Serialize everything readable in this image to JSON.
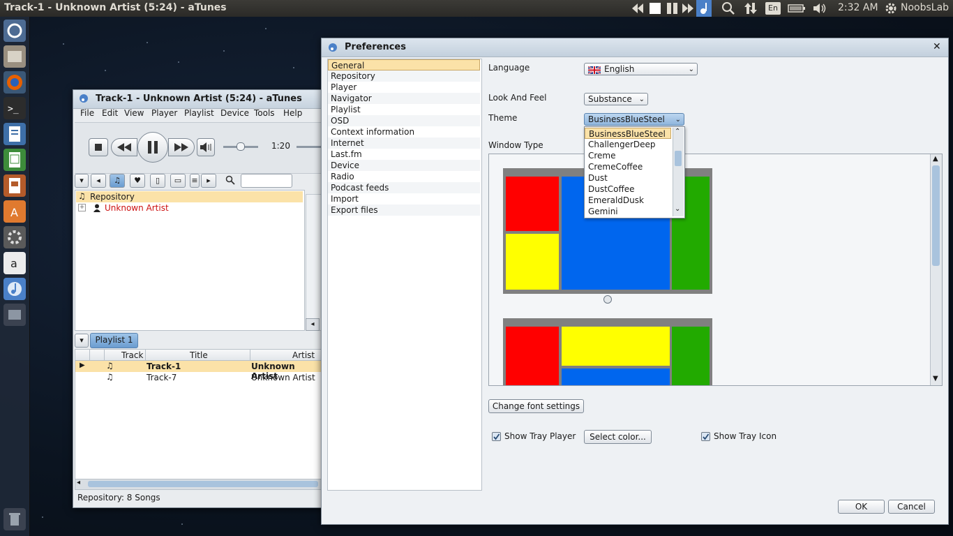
{
  "top_panel": {
    "title": "Track-1 - Unknown Artist (5:24) - aTunes",
    "time": "2:32 AM",
    "keyboard_layout": "En",
    "user": "NoobsLab"
  },
  "launcher": {
    "items": [
      "dash-icon",
      "files-icon",
      "firefox-icon",
      "terminal-icon",
      "writer-icon",
      "calc-icon",
      "impress-icon",
      "software-center-icon",
      "settings-icon",
      "amazon-icon",
      "atunes-icon",
      "workspace-icon",
      "trash-icon"
    ]
  },
  "atunes": {
    "title": "Track-1 - Unknown Artist (5:24) - aTunes",
    "menu": [
      "File",
      "Edit",
      "View",
      "Player",
      "Playlist",
      "Device",
      "Tools",
      "Help"
    ],
    "time_elapsed": "1:20",
    "tree_root": "Repository",
    "tree_child": "Unknown Artist",
    "playlist_tab": "Playlist 1",
    "columns": [
      "Track",
      "Title",
      "Artist"
    ],
    "rows": [
      {
        "title": "Track-1",
        "artist": "Unknown Artist"
      },
      {
        "title": "Track-7",
        "artist": "Unknown Artist"
      }
    ],
    "status": "Repository: 8 Songs"
  },
  "prefs": {
    "title": "Preferences",
    "nav": [
      "General",
      "Repository",
      "Player",
      "Navigator",
      "Playlist",
      "OSD",
      "Context information",
      "Internet",
      "Last.fm",
      "Device",
      "Radio",
      "Podcast feeds",
      "Import",
      "Export files"
    ],
    "selected_nav": "General",
    "language_label": "Language",
    "language_value": "English",
    "laf_label": "Look And Feel",
    "laf_value": "Substance",
    "theme_label": "Theme",
    "theme_value": "BusinessBlueSteel",
    "theme_options": [
      "BusinessBlueSteel",
      "ChallengerDeep",
      "Creme",
      "CremeCoffee",
      "Dust",
      "DustCoffee",
      "EmeraldDusk",
      "Gemini"
    ],
    "window_type_label": "Window Type",
    "font_button": "Change font settings",
    "show_tray_player": "Show Tray Player",
    "select_color": "Select color...",
    "show_tray_icon": "Show Tray Icon",
    "ok": "OK",
    "cancel": "Cancel"
  },
  "colors": {
    "red": "#ff0000",
    "blue": "#0066ee",
    "green": "#22aa00",
    "yellow": "#ffff00",
    "selection": "#fbe2a8"
  }
}
